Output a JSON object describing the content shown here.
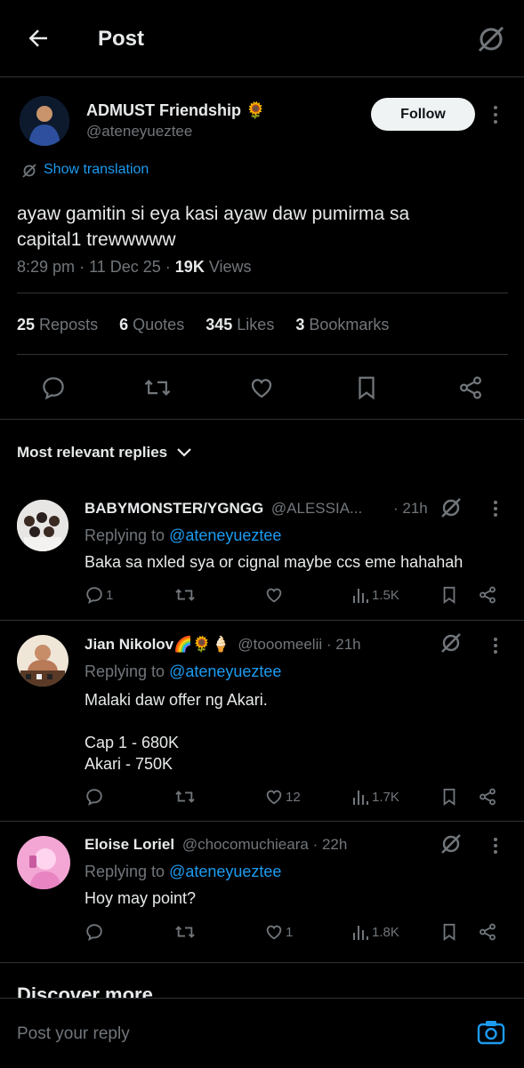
{
  "header": {
    "title": "Post"
  },
  "post": {
    "author_name": "ADMUST Friendship",
    "author_emoji": "🌻",
    "author_handle": "@ateneyueztee",
    "follow_label": "Follow",
    "show_translation": "Show translation",
    "text_line1": "ayaw gamitin si eya kasi ayaw daw pumirma sa",
    "text_line2": "capital1 trewwwww",
    "time": "8:29 pm",
    "date": "11 Dec 25",
    "views_count": "19K",
    "views_label": "Views",
    "stats": {
      "reposts_num": "25",
      "reposts_label": "Reposts",
      "quotes_num": "6",
      "quotes_label": "Quotes",
      "likes_num": "345",
      "likes_label": "Likes",
      "bookmarks_num": "3",
      "bookmarks_label": "Bookmarks"
    }
  },
  "replies_sort": "Most relevant replies",
  "replies": [
    {
      "name": "BABYMONSTER/YGNGG",
      "handle": "@ALESSIA...",
      "time": "· 21h",
      "replying_prefix": "Replying to",
      "replying_handle": "@ateneyueztee",
      "text1": "Baka sa nxled sya or cignal maybe ccs eme hahahah",
      "comments": "1",
      "likes": "",
      "views": "1.5K"
    },
    {
      "name": "Jian Nikolov🌈🌻🍦",
      "handle": "@tooomeelii",
      "time": "· 21h",
      "replying_prefix": "Replying to",
      "replying_handle": "@ateneyueztee",
      "text1": "Malaki daw offer ng Akari.",
      "text2": "Cap 1 - 680K",
      "text3": "Akari - 750K",
      "comments": "",
      "likes": "12",
      "views": "1.7K"
    },
    {
      "name": "Eloise Loriel",
      "handle": "@chocomuchieara",
      "time": "· 22h",
      "replying_prefix": "Replying to",
      "replying_handle": "@ateneyueztee",
      "text1": "Hoy may point?",
      "comments": "",
      "likes": "1",
      "views": "1.8K"
    }
  ],
  "discover_more": "Discover more",
  "reply_placeholder": "Post your reply",
  "colors": {
    "accent": "#1d9bf0",
    "background": "#000000",
    "text": "#e7e9ea",
    "muted": "#71767b"
  }
}
